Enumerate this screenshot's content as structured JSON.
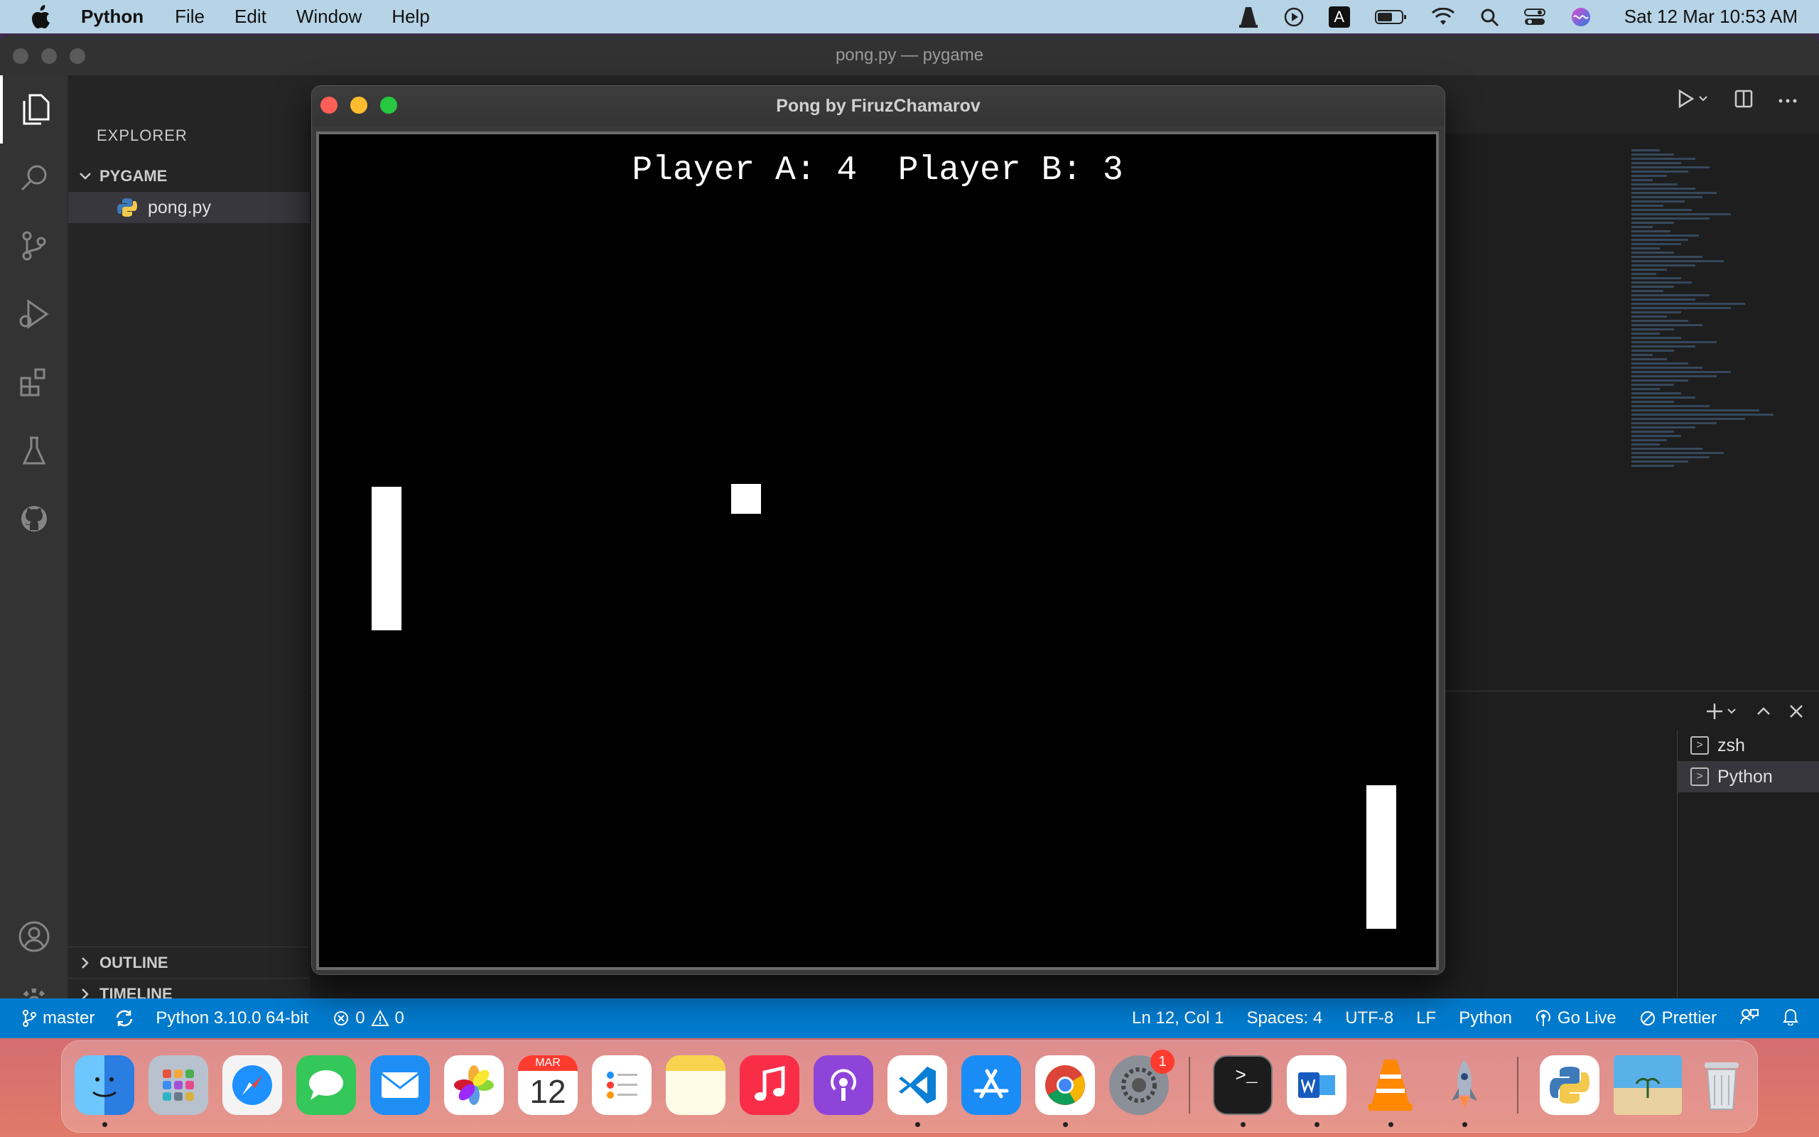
{
  "menubar": {
    "app_name": "Python",
    "items": [
      "File",
      "Edit",
      "Window",
      "Help"
    ],
    "clock": "Sat 12 Mar  10:53 AM",
    "keyboard_indicator": "A"
  },
  "vscode": {
    "window_title": "pong.py — pygame",
    "explorer_title": "EXPLORER",
    "folder": "PYGAME",
    "file": "pong.py",
    "outline": "OUTLINE",
    "timeline": "TIMELINE",
    "terminals": [
      "zsh",
      "Python"
    ]
  },
  "statusbar": {
    "branch": "master",
    "interpreter": "Python 3.10.0 64-bit",
    "errors": "0",
    "warnings": "0",
    "position": "Ln 12, Col 1",
    "spaces": "Spaces: 4",
    "encoding": "UTF-8",
    "eol": "LF",
    "language": "Python",
    "go_live": "Go Live",
    "prettier": "Prettier"
  },
  "pong": {
    "window_title": "Pong by FiruzChamarov",
    "score_text": "Player A: 4  Player B: 3",
    "player_a_score": 4,
    "player_b_score": 3
  },
  "dock": {
    "calendar_month": "MAR",
    "calendar_day": "12",
    "settings_badge": "1",
    "apps": [
      "finder-icon",
      "launchpad-icon",
      "safari-icon",
      "messages-icon",
      "mail-icon",
      "photos-icon",
      "calendar-icon",
      "reminders-icon",
      "notes-icon",
      "music-icon",
      "podcasts-icon",
      "vscode-icon",
      "app-store-icon",
      "chrome-icon",
      "system-preferences-icon",
      "terminal-icon",
      "word-icon",
      "vlc-icon",
      "rocket-icon",
      "python-launcher-icon",
      "preview-icon",
      "trash-icon"
    ]
  },
  "colors": {
    "menubar_bg": "#b7d3e6",
    "statusbar_bg": "#007acc",
    "close": "#ff5f57",
    "minimize": "#febc2e",
    "zoom": "#28c840"
  }
}
